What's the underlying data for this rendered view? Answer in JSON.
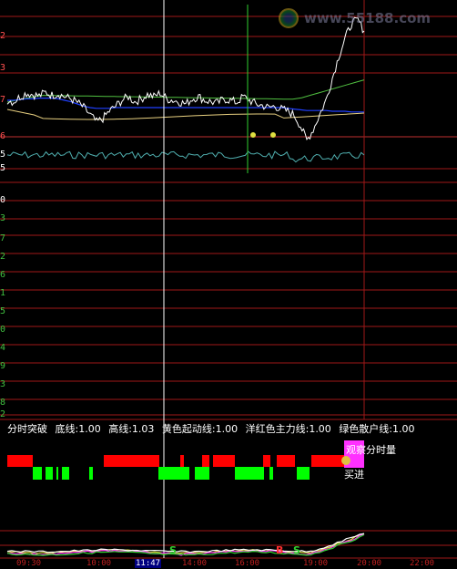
{
  "watermark": {
    "text": "www.55188.com"
  },
  "y_axis_labels": [
    {
      "text": "2",
      "color": "#ff5050"
    },
    {
      "text": "3",
      "color": "#ff5050"
    },
    {
      "text": "7",
      "color": "#ff5050"
    },
    {
      "text": "6",
      "color": "#ff5050"
    },
    {
      "text": "5",
      "color": "#ffffff"
    },
    {
      "text": "5",
      "color": "#ffffff"
    },
    {
      "text": "0",
      "color": "#ffffff"
    },
    {
      "text": "3",
      "color": "#40c040"
    },
    {
      "text": "7",
      "color": "#40c040"
    },
    {
      "text": "2",
      "color": "#40c040"
    },
    {
      "text": "6",
      "color": "#40c040"
    },
    {
      "text": "1",
      "color": "#40c040"
    },
    {
      "text": "5",
      "color": "#40c040"
    },
    {
      "text": "0",
      "color": "#40c040"
    },
    {
      "text": "4",
      "color": "#40c040"
    },
    {
      "text": "9",
      "color": "#40c040"
    },
    {
      "text": "3",
      "color": "#40c040"
    },
    {
      "text": "8",
      "color": "#40c040"
    },
    {
      "text": "2",
      "color": "#40c040"
    }
  ],
  "indicator_info": {
    "name": "分时突破",
    "params": [
      "底线:1.00",
      "高线:1.03",
      "黄色起动线:1.00",
      "洋红色主力线:1.00",
      "绿色散户线:1.00"
    ]
  },
  "labels": {
    "observe": "观察分时量",
    "buy": "买进",
    "marker_s": "S",
    "marker_b": "B"
  },
  "x_axis_labels": [
    "09:30",
    "10:00",
    "11:47",
    "14:00",
    "16:00",
    "19:00",
    "20:00",
    "22:00"
  ],
  "x_axis_selected_index": 2,
  "colors": {
    "grid_red": "#a01818",
    "price_white": "#ffffff",
    "avg_blue": "#2040ff",
    "ma_yellow": "#e8d080",
    "ma_green": "#50c040",
    "cyan": "#50b0b0",
    "bar_red": "#ff0000",
    "bar_green": "#00ff00",
    "magenta": "#ff30ff",
    "crosshair": "#ffffff",
    "vline_green": "#30d030"
  },
  "chart_data": {
    "type": "line",
    "price_series": [
      0.5,
      0.48,
      0.55,
      0.6,
      0.58,
      0.56,
      0.61,
      0.57,
      0.59,
      0.55,
      0.52,
      0.47,
      0.4,
      0.3,
      0.2,
      0.25,
      0.35,
      0.42,
      0.5,
      0.55,
      0.48,
      0.52,
      0.58,
      0.55,
      0.6,
      0.52,
      0.5,
      0.48,
      0.45,
      0.52,
      0.55,
      0.5,
      0.48,
      0.46,
      0.52,
      0.5,
      0.47,
      0.55,
      0.5,
      0.45,
      0.43,
      0.4,
      0.42,
      0.38,
      0.35,
      0.3,
      0.15,
      -0.05,
      0.1,
      0.3,
      0.5,
      0.8,
      1.1,
      1.35,
      1.55,
      1.6,
      1.45
    ],
    "avg_series": [
      0.5,
      0.5,
      0.51,
      0.52,
      0.52,
      0.53,
      0.53,
      0.53,
      0.52,
      0.5,
      0.48,
      0.45,
      0.42,
      0.4,
      0.39,
      0.39,
      0.39,
      0.4,
      0.4,
      0.4,
      0.4,
      0.4,
      0.4,
      0.4,
      0.4,
      0.4,
      0.4,
      0.4,
      0.4,
      0.4,
      0.4,
      0.4,
      0.4,
      0.4,
      0.4,
      0.4,
      0.4,
      0.4,
      0.4,
      0.4,
      0.4,
      0.4,
      0.4,
      0.4,
      0.39,
      0.38,
      0.37,
      0.36,
      0.36,
      0.36,
      0.36,
      0.35,
      0.35,
      0.35,
      0.34,
      0.34,
      0.34
    ]
  }
}
